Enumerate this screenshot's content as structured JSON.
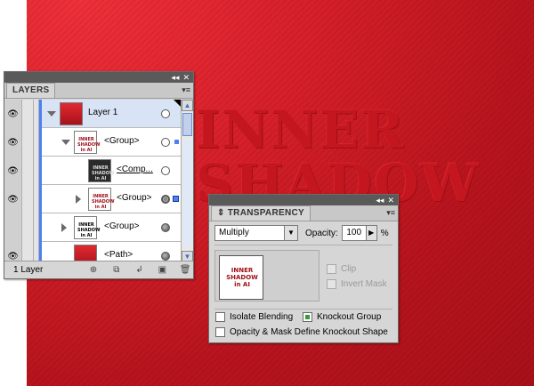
{
  "artwork": {
    "line1": "INNER",
    "line2": "SHADOW",
    "thumb_text": "INNER SHADOW in AI"
  },
  "layers_panel": {
    "tab": "LAYERS",
    "topbar": {
      "collapse": "◂◂",
      "close": "✕"
    },
    "menu": "▾≡",
    "rows": [
      {
        "name": "Layer 1",
        "indent": "layer",
        "thumb": "red"
      },
      {
        "name": "<Group>",
        "indent": "sub1",
        "thumb": "white"
      },
      {
        "name": "<Comp...",
        "indent": "sub2",
        "thumb": "dark"
      },
      {
        "name": "<Group>",
        "indent": "sub1c",
        "thumb": "white"
      },
      {
        "name": "<Group>",
        "indent": "top",
        "thumb": "text"
      },
      {
        "name": "<Path>",
        "indent": "top",
        "thumb": "red"
      }
    ],
    "footer_text": "1 Layer",
    "footer_icons": [
      "locate-object-icon",
      "make-clipping-mask-icon",
      "new-sublayer-icon",
      "new-layer-icon",
      "trash-icon"
    ]
  },
  "transparency_panel": {
    "tab": "TRANSPARENCY",
    "topbar": {
      "collapse": "◂◂",
      "close": "✕"
    },
    "menu": "▾≡",
    "blend_mode": "Multiply",
    "opacity_label": "Opacity:",
    "opacity_value": "100",
    "opacity_unit": "%",
    "clip_label": "Clip",
    "invert_mask_label": "Invert Mask",
    "isolate_blending_label": "Isolate Blending",
    "knockout_group_label": "Knockout Group",
    "opacity_mask_label": "Opacity & Mask Define Knockout Shape"
  },
  "colors": {
    "layer_color": "#4f7ff5",
    "artboard_red": "#d8202a"
  }
}
